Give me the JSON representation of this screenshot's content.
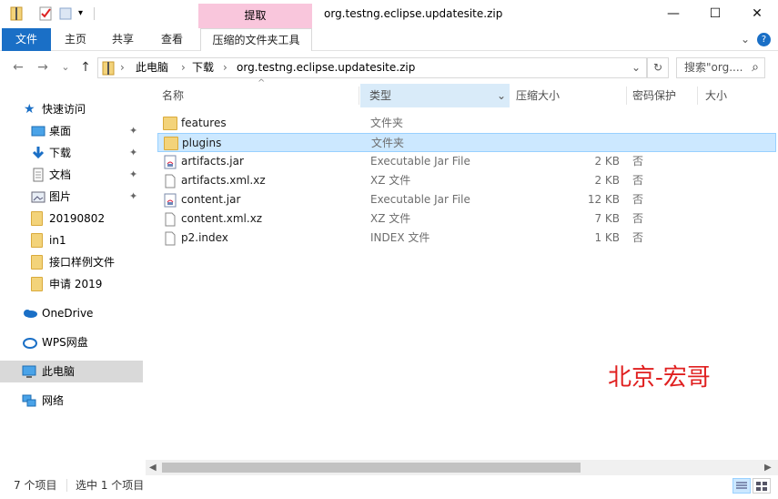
{
  "title": {
    "context_tab": "提取",
    "window_title": "org.testng.eclipse.updatesite.zip",
    "minimize": "—",
    "maximize": "☐",
    "close": "✕"
  },
  "ribbon": {
    "tabs": [
      "文件",
      "主页",
      "共享",
      "查看",
      "压缩的文件夹工具"
    ],
    "collapse": "⌄",
    "help": "?"
  },
  "address": {
    "back": "←",
    "forward": "→",
    "dropdown": "⌄",
    "up": "↑",
    "breadcrumb": [
      "此电脑",
      "下载",
      "org.testng.eclipse.updatesite.zip"
    ],
    "separator": "›",
    "addr_dropdown": "⌄",
    "refresh": "↻",
    "search_placeholder": "搜索\"org....",
    "search_icon": "⌕"
  },
  "nav": {
    "quick_access": "快速访问",
    "items": [
      {
        "label": "桌面",
        "icon": "desktop-icon",
        "pinned": true
      },
      {
        "label": "下载",
        "icon": "download-icon",
        "pinned": true
      },
      {
        "label": "文档",
        "icon": "document-icon",
        "pinned": true
      },
      {
        "label": "图片",
        "icon": "picture-icon",
        "pinned": true
      },
      {
        "label": "20190802",
        "icon": "folder-icon",
        "pinned": false
      },
      {
        "label": "in1",
        "icon": "folder-icon",
        "pinned": false
      },
      {
        "label": "接口样例文件",
        "icon": "folder-icon",
        "pinned": false
      },
      {
        "label": "申请 2019",
        "icon": "folder-icon",
        "pinned": false
      }
    ],
    "onedrive": "OneDrive",
    "wps": "WPS网盘",
    "this_pc": "此电脑",
    "network": "网络",
    "pin_glyph": "📌"
  },
  "columns": {
    "name": "名称",
    "type": "类型",
    "compressed_size": "压缩大小",
    "password": "密码保护",
    "size": "大小"
  },
  "files": [
    {
      "name": "features",
      "type": "文件夹",
      "size": "",
      "password": "",
      "icon": "folder-icon"
    },
    {
      "name": "plugins",
      "type": "文件夹",
      "size": "",
      "password": "",
      "icon": "folder-icon",
      "selected": true
    },
    {
      "name": "artifacts.jar",
      "type": "Executable Jar File",
      "size": "2 KB",
      "password": "否",
      "icon": "jar-file-icon"
    },
    {
      "name": "artifacts.xml.xz",
      "type": "XZ 文件",
      "size": "2 KB",
      "password": "否",
      "icon": "file-icon"
    },
    {
      "name": "content.jar",
      "type": "Executable Jar File",
      "size": "12 KB",
      "password": "否",
      "icon": "jar-file-icon"
    },
    {
      "name": "content.xml.xz",
      "type": "XZ 文件",
      "size": "7 KB",
      "password": "否",
      "icon": "file-icon"
    },
    {
      "name": "p2.index",
      "type": "INDEX 文件",
      "size": "1 KB",
      "password": "否",
      "icon": "file-icon"
    }
  ],
  "watermark": "北京-宏哥",
  "status": {
    "item_count": "7 个项目",
    "selected": "选中 1 个项目"
  },
  "colors": {
    "accent": "#1a6fc6",
    "context_tab": "#f9c6dc",
    "selection": "#cce8ff",
    "watermark": "#e02020"
  }
}
